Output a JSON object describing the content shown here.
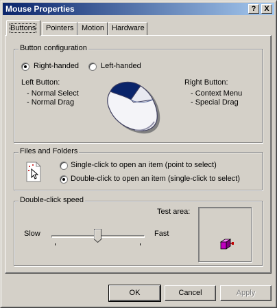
{
  "window": {
    "title": "Mouse Properties",
    "help_glyph": "?",
    "close_glyph": "X"
  },
  "tabs": [
    {
      "label": "Buttons",
      "active": true
    },
    {
      "label": "Pointers",
      "active": false
    },
    {
      "label": "Motion",
      "active": false
    },
    {
      "label": "Hardware",
      "active": false
    }
  ],
  "button_config": {
    "group_label": "Button configuration",
    "right_handed": {
      "label": "Right-handed",
      "selected": true
    },
    "left_handed": {
      "label": "Left-handed",
      "selected": false
    },
    "left_button": {
      "title": "Left Button:",
      "items": [
        "- Normal Select",
        "- Normal Drag"
      ]
    },
    "right_button": {
      "title": "Right Button:",
      "items": [
        "- Context Menu",
        "- Special Drag"
      ]
    },
    "mouse_icon": "mouse-icon"
  },
  "files_folders": {
    "group_label": "Files and Folders",
    "single_click": {
      "label": "Single-click to open an item (point to select)",
      "selected": false
    },
    "double_click": {
      "label": "Double-click to open an item (single-click to select)",
      "selected": true
    },
    "icon": "document-pointer-icon"
  },
  "double_click_speed": {
    "group_label": "Double-click speed",
    "slow_label": "Slow",
    "fast_label": "Fast",
    "test_area_label": "Test area:",
    "slider_value": 0.5,
    "test_icon": "jack-in-box-icon"
  },
  "footer": {
    "ok_label": "OK",
    "cancel_label": "Cancel",
    "apply_label": "Apply"
  },
  "colors": {
    "title_gradient_start": "#0a246a",
    "title_gradient_end": "#a6caf0",
    "face": "#d4d0c8",
    "mouse_button_highlight": "#0a246a",
    "test_box": "#c000c0"
  }
}
